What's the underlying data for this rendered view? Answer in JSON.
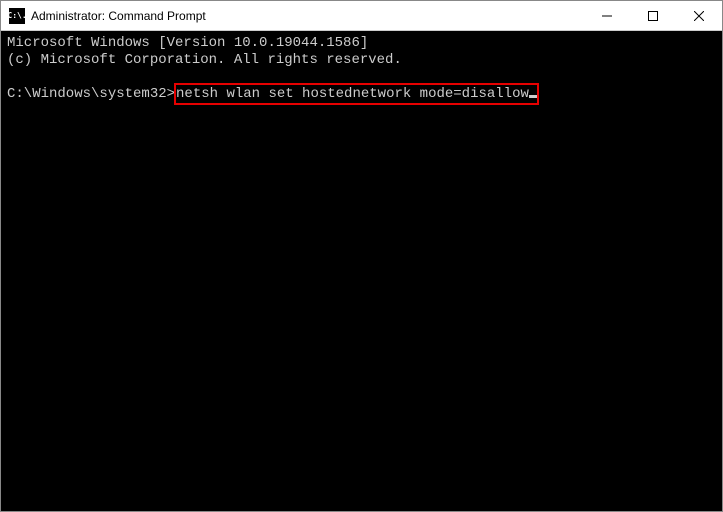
{
  "titlebar": {
    "icon_text": "C:\\.",
    "title": "Administrator: Command Prompt",
    "minimize": "—",
    "maximize": "□",
    "close": "✕"
  },
  "terminal": {
    "line1": "Microsoft Windows [Version 10.0.19044.1586]",
    "line2": "(c) Microsoft Corporation. All rights reserved.",
    "prompt": "C:\\Windows\\system32>",
    "command": "netsh wlan set hostednetwork mode=disallow"
  }
}
